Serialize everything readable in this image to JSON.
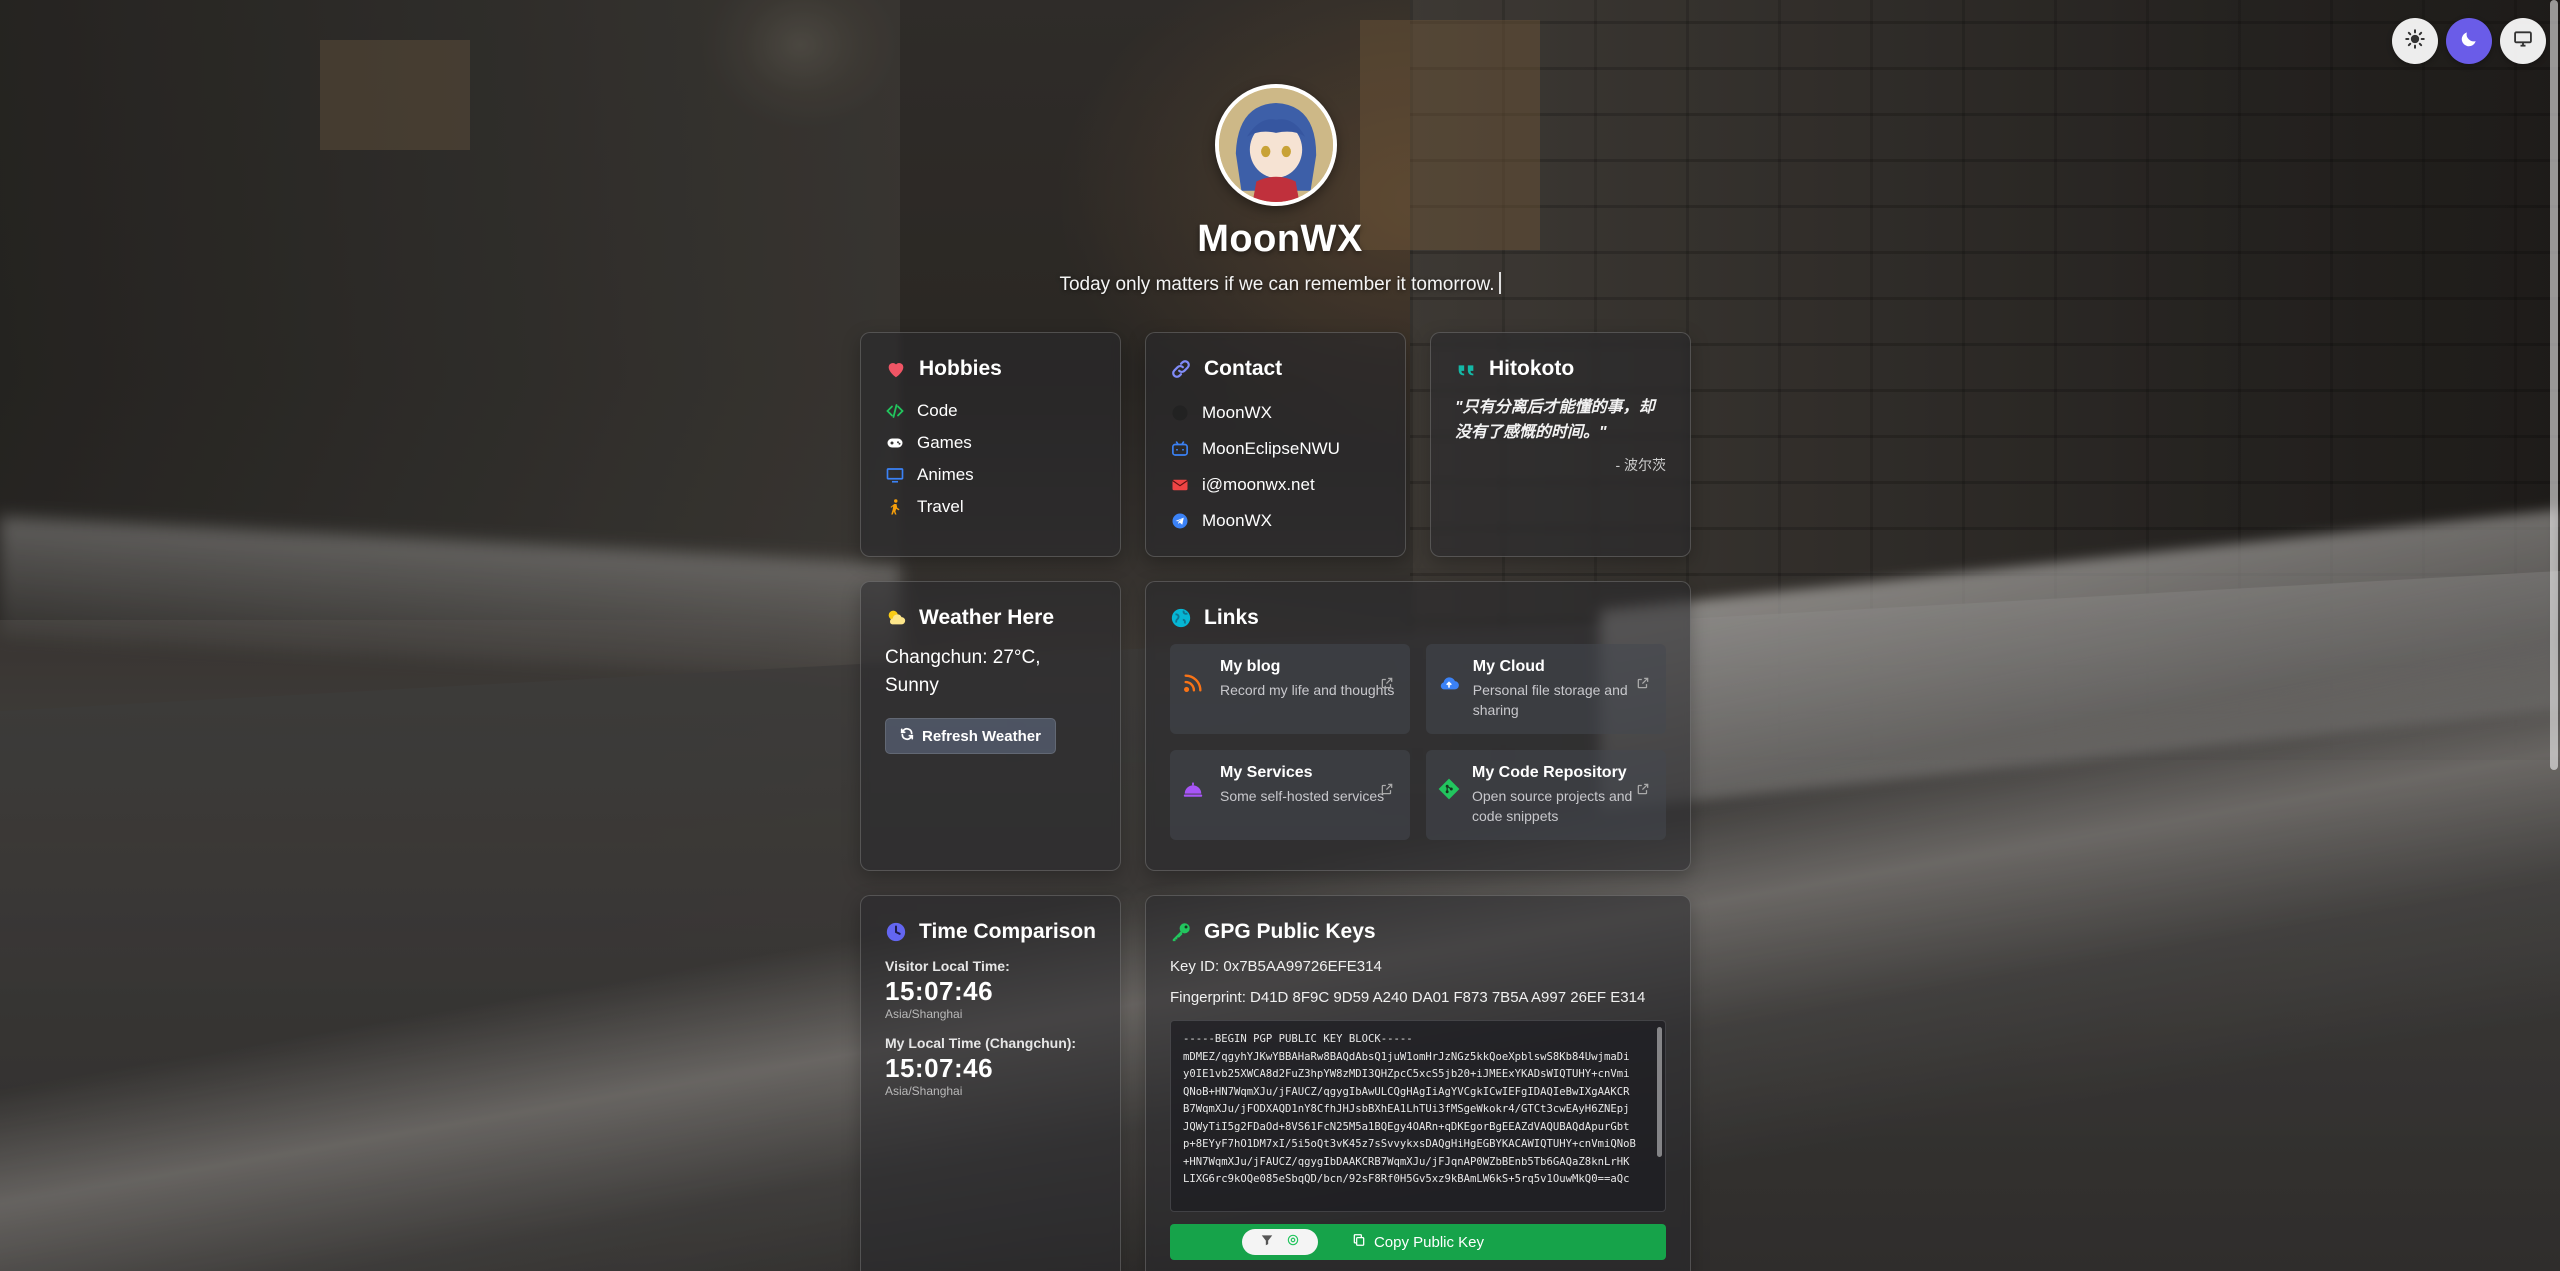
{
  "theme": {
    "light_label": "light",
    "dark_label": "dark",
    "system_label": "system",
    "active": "dark",
    "accent": "#6a5ce8"
  },
  "profile": {
    "name": "MoonWX",
    "tagline": "Today only matters if we can remember it tomorrow."
  },
  "hobbies": {
    "title": "Hobbies",
    "items": [
      {
        "label": "Code",
        "icon": "code-icon",
        "color": "#22c55e"
      },
      {
        "label": "Games",
        "icon": "gamepad-icon",
        "color": "#ffffff"
      },
      {
        "label": "Animes",
        "icon": "monitor-icon",
        "color": "#3b82f6"
      },
      {
        "label": "Travel",
        "icon": "person-walking-icon",
        "color": "#f59e0b"
      }
    ]
  },
  "contact": {
    "title": "Contact",
    "items": [
      {
        "label": "MoonWX",
        "icon": "github-icon",
        "color": "#222222"
      },
      {
        "label": "MoonEclipseNWU",
        "icon": "bilibili-icon",
        "color": "#3b82f6"
      },
      {
        "label": "i@moonwx.net",
        "icon": "envelope-icon",
        "color": "#ef4444"
      },
      {
        "label": "MoonWX",
        "icon": "telegram-icon",
        "color": "#3b82f6"
      }
    ]
  },
  "hitokoto": {
    "title": "Hitokoto",
    "quote": "\"只有分离后才能懂的事，却没有了感慨的时间。\"",
    "author": "- 波尔茨"
  },
  "weather": {
    "title": "Weather Here",
    "text": "Changchun: 27°C, Sunny",
    "button": "Refresh Weather"
  },
  "links": {
    "title": "Links",
    "items": [
      {
        "title": "My blog",
        "desc": "Record my life and thoughts",
        "icon": "rss-icon",
        "color": "#f97316"
      },
      {
        "title": "My Cloud",
        "desc": "Personal file storage and sharing",
        "icon": "cloud-icon",
        "color": "#3b82f6"
      },
      {
        "title": "My Services",
        "desc": "Some self-hosted services",
        "icon": "bell-service-icon",
        "color": "#a855f7"
      },
      {
        "title": "My Code Repository",
        "desc": "Open source projects and code snippets",
        "icon": "git-icon",
        "color": "#22c55e"
      }
    ]
  },
  "time": {
    "title": "Time Comparison",
    "visitor_label": "Visitor Local Time:",
    "visitor_time": "15:07:46",
    "visitor_zone": "Asia/Shanghai",
    "local_label": "My Local Time (Changchun):",
    "local_time": "15:07:46",
    "local_zone": "Asia/Shanghai"
  },
  "gpg": {
    "title": "GPG Public Keys",
    "key_id": "Key ID: 0x7B5AA99726EFE314",
    "fingerprint": "Fingerprint: D41D 8F9C 9D59 A240 DA01 F873 7B5A A997 26EF E314",
    "block": "-----BEGIN PGP PUBLIC KEY BLOCK-----\nmDMEZ/qgyhYJKwYBBAHaRw8BAQdAbsQ1juW1omHrJzNGz5kkQoeXpblswS8Kb84UwjmaDi\ny0IE1vb25XWCA8d2FuZ3hpYW8zMDI3QHZpcC5xcS5jb20+iJMEExYKADsWIQTUHY+cnVmi\nQNoB+HN7WqmXJu/jFAUCZ/qgygIbAwULCQgHAgIiAgYVCgkICwIEFgIDAQIeBwIXgAAKCR\nB7WqmXJu/jFODXAQD1nY8CfhJHJsbBXhEA1LhTUi3fMSgeWkokr4/GTCt3cwEAyH6ZNEpj\nJQWyTiI5g2FDaOd+8VS61FcN25M5a1BQEgy4OARn+qDKEgorBgEEAZdVAQUBAQdApurGbt\np+8EYyF7hO1DM7xI/5i5oQt3vK45z7sSvvykxsDAQgHiHgEGBYKACAWIQTUHY+cnVmiQNoB\n+HN7WqmXJu/jFAUCZ/qgygIbDAAKCRB7WqmXJu/jFJqnAP0WZbBEnb5Tb6GAQaZ8knLrHK\nLIXG6rc9kOQe085eSbqQD/bcn/92sF8Rf0H5Gv5xz9kBAmLW6kS+5rq5v1OuwMkQ0==aQc",
    "copy_button": "Copy Public Key"
  }
}
